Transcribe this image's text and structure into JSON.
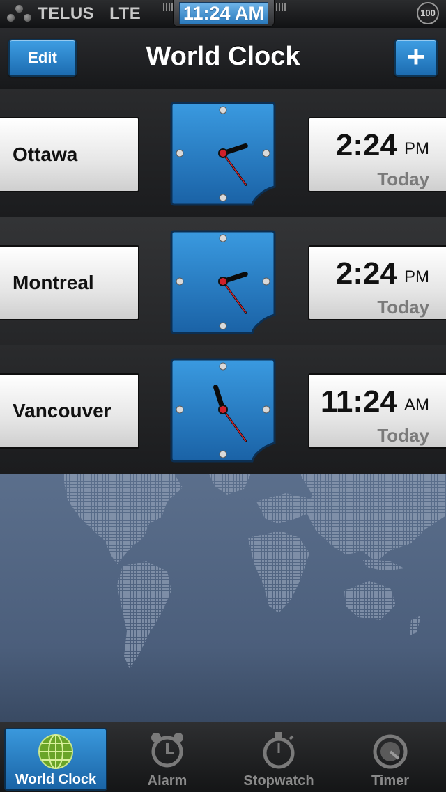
{
  "status_bar": {
    "carrier": "TELUS",
    "network": "LTE",
    "time": "11:24 AM",
    "battery": "100"
  },
  "nav": {
    "edit_label": "Edit",
    "title": "World Clock",
    "add_label": "+"
  },
  "clocks": [
    {
      "city": "Ottawa",
      "time": "2:24",
      "ampm": "PM",
      "day": "Today",
      "hour": 2,
      "minute": 24
    },
    {
      "city": "Montreal",
      "time": "2:24",
      "ampm": "PM",
      "day": "Today",
      "hour": 2,
      "minute": 24
    },
    {
      "city": "Vancouver",
      "time": "11:24",
      "ampm": "AM",
      "day": "Today",
      "hour": 11,
      "minute": 24
    }
  ],
  "tabs": [
    {
      "label": "World Clock",
      "icon": "globe-icon",
      "active": true
    },
    {
      "label": "Alarm",
      "icon": "alarm-clock-icon",
      "active": false
    },
    {
      "label": "Stopwatch",
      "icon": "stopwatch-icon",
      "active": false
    },
    {
      "label": "Timer",
      "icon": "timer-icon",
      "active": false
    }
  ],
  "colors": {
    "accent_blue": "#1f78c1",
    "hand_red": "#d0202a",
    "map_blue": "#50627f"
  }
}
